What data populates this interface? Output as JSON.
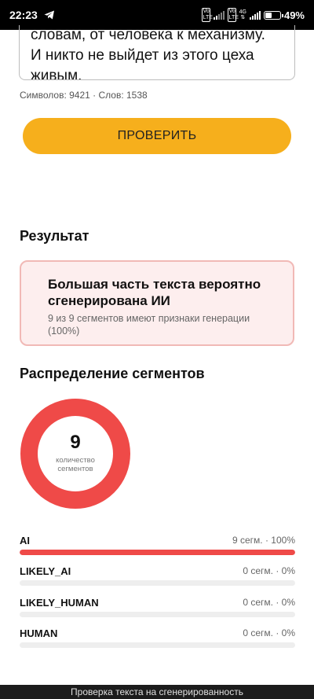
{
  "status_bar": {
    "time": "22:23",
    "sim1_label": "Vo LTE",
    "sim2_label": "Vo LTE",
    "network_type": "4G",
    "battery_percent": "49%",
    "battery_level": 0.49
  },
  "editor": {
    "lines": [
      "словам, от человека к механизму.",
      "И никто не выйдет из этого цеха",
      "живым."
    ],
    "counter": "Символов: 9421 · Слов: 1538"
  },
  "check_button": {
    "label": "ПРОВЕРИТЬ"
  },
  "result": {
    "title": "Результат",
    "headline": "Большая часть текста вероятно сгенерирована ИИ",
    "subtext": "9 из 9 сегментов имеют признаки генерации (100%)",
    "colors": {
      "card_bg": "#fdeeee",
      "card_border": "#f1b9b6"
    }
  },
  "distribution": {
    "title": "Распределение сегментов",
    "donut": {
      "value": "9",
      "label_line1": "количество",
      "label_line2": "сегментов"
    },
    "rows": [
      {
        "name": "AI",
        "value_text": "9 сегм. · 100%",
        "fraction": 1.0,
        "color": "#ef4a48"
      },
      {
        "name": "LIKELY_AI",
        "value_text": "0 сегм. · 0%",
        "fraction": 0.0,
        "color": "#f28b3a"
      },
      {
        "name": "LIKELY_HUMAN",
        "value_text": "0 сегм. · 0%",
        "fraction": 0.0,
        "color": "#8bc34a"
      },
      {
        "name": "HUMAN",
        "value_text": "0 сегм. · 0%",
        "fraction": 0.0,
        "color": "#4caf50"
      }
    ],
    "track_color": "#eeeeee"
  },
  "footer": {
    "label": "Проверка текста на сгенерированность"
  },
  "colors": {
    "accent": "#f6af1c",
    "ai_red": "#ef4a48"
  }
}
